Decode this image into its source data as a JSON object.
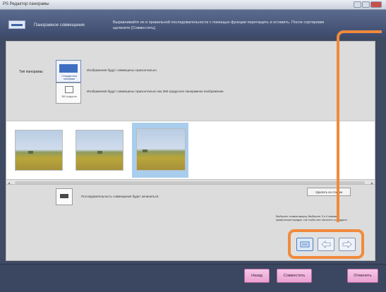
{
  "window": {
    "title": "PS Редактор панорамы"
  },
  "header": {
    "mode_title": "Панорамное совмещение",
    "instructions": "Выравнивайте их в правильной последовательности с помощью функции перетащить и оставить. После сортировки щелкните [Совместить]."
  },
  "panorama_type": {
    "label": "Тип панорамы:",
    "option_standard": {
      "caption": "Стандартная панорама",
      "description": "Изображения будут совмещены горизонтально."
    },
    "option_360": {
      "caption": "360 градусов",
      "description": "Изображения будут совмещены горизонтально как 360-градусное панорамное изображение."
    }
  },
  "thumbnails": [
    {
      "name": "Снимок 1",
      "selected": false
    },
    {
      "name": "Снимок 2",
      "selected": false
    },
    {
      "name": "Снимок 3",
      "selected": true
    }
  ],
  "order": {
    "text": "Последовательность совмещения будет начинаться.",
    "delete_label": "Удалить из списка",
    "select_note": "Выберите снимок вверху. Выберите 3 и 4 снимка в правильном порядке, так чтобы они частично совпадали."
  },
  "footer": {
    "back_label": "Назад",
    "stitch_label": "Совместить",
    "cancel_label": "Отменить"
  },
  "colors": {
    "accent": "#f08a3c",
    "button_pink": "#f6c7e7",
    "selection_blue": "#a9cdec"
  }
}
